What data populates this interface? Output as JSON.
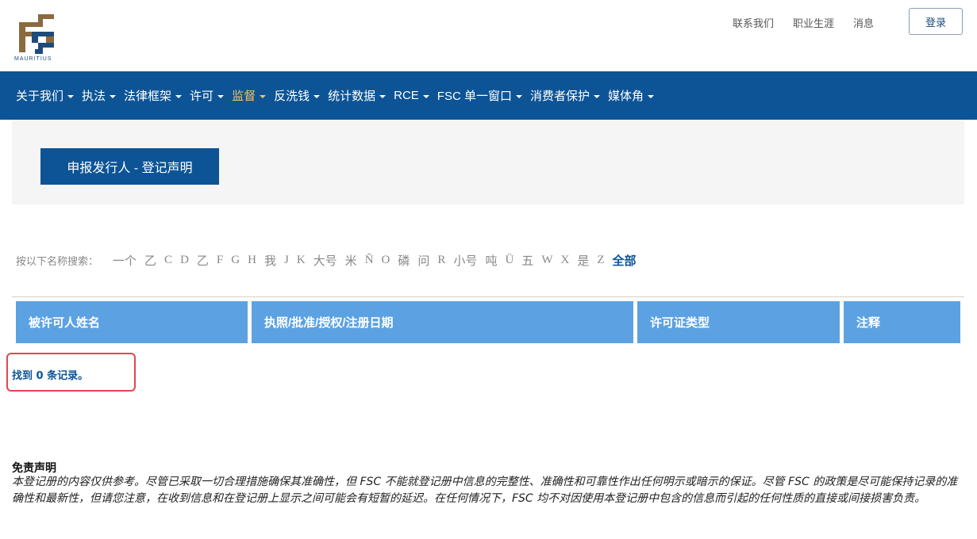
{
  "brand": {
    "logo_text": "MAURITIUS",
    "primary": "#0d5496",
    "gold": "#f0c36a",
    "logo_brown": "#8b6a3e"
  },
  "toplinks": [
    "联系我们",
    "职业生涯",
    "消息"
  ],
  "login_label": "登录",
  "nav": [
    {
      "label": "关于我们",
      "active": false
    },
    {
      "label": "执法",
      "active": false
    },
    {
      "label": "法律框架",
      "active": false
    },
    {
      "label": "许可",
      "active": false
    },
    {
      "label": "监督",
      "active": true
    },
    {
      "label": "反洗钱",
      "active": false
    },
    {
      "label": "统计数据",
      "active": false
    },
    {
      "label": "RCE",
      "active": false
    },
    {
      "label": "FSC 单一窗口",
      "active": false
    },
    {
      "label": "消费者保护",
      "active": false
    },
    {
      "label": "媒体角",
      "active": false
    }
  ],
  "page_title": "申报发行人 - 登记声明",
  "search": {
    "label": "按以下名称搜索：",
    "letters": [
      "一个",
      "乙",
      "C",
      "D",
      "乙",
      "F",
      "G",
      "H",
      "我",
      "J",
      "K",
      "大号",
      "米",
      "Ñ",
      "O",
      "磷",
      "问",
      "R",
      "小号",
      "吨",
      "Ü",
      "五",
      "W",
      "X",
      "是",
      "Z"
    ],
    "all_label": "全部"
  },
  "table": {
    "headers": [
      "被许可人姓名",
      "执照/批准/授权/注册日期",
      "许可证类型",
      "注释"
    ]
  },
  "result_text": "找到 0 条记录。",
  "disclaimer": {
    "title": "免责声明",
    "text": "本登记册的内容仅供参考。尽管已采取一切合理措施确保其准确性，但 FSC 不能就登记册中信息的完整性、准确性和可靠性作出任何明示或暗示的保证。尽管 FSC 的政策是尽可能保持记录的准确性和最新性，但请您注意，在收到信息和在登记册上显示之间可能会有短暂的延迟。在任何情况下，FSC 均不对因使用本登记册中包含的信息而引起的任何性质的直接或间接损害负责。"
  }
}
